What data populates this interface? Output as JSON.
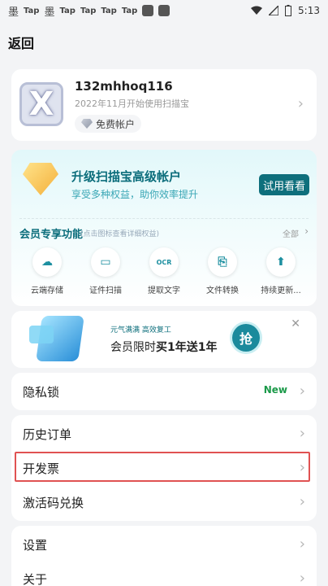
{
  "status_bar": {
    "app_icons": [
      "Tap",
      "Tap",
      "Tap",
      "Tap",
      "Tap"
    ],
    "time": "5:13"
  },
  "nav": {
    "back_label": "返回"
  },
  "profile": {
    "username": "132mhhoq116",
    "since": "2022年11月开始使用扫描宝",
    "account_type": "免费帐户"
  },
  "vip": {
    "title": "升级扫描宝高级帐户",
    "subtitle": "享受多种权益，助你效率提升",
    "try_label": "试用看看",
    "features_title": "会员专享功能",
    "features_hint": "(点击图标查看详细权益)",
    "all_label": "全部",
    "features": [
      {
        "label": "云端存储",
        "icon": "cloud-icon"
      },
      {
        "label": "证件扫描",
        "icon": "id-card-icon"
      },
      {
        "label": "提取文字",
        "icon": "ocr-icon"
      },
      {
        "label": "文件转换",
        "icon": "pdf-icon"
      },
      {
        "label": "持续更新...",
        "icon": "arrow-up-icon"
      }
    ]
  },
  "banner": {
    "small_text": "元气满满  高效复工",
    "main_prefix": "会员限时",
    "main_bold": "买1年送1年",
    "grab_label": "抢"
  },
  "menu": {
    "group1": [
      {
        "label": "隐私锁",
        "tag": "New"
      }
    ],
    "group2": [
      {
        "label": "历史订单"
      },
      {
        "label": "开发票"
      },
      {
        "label": "激活码兑换"
      }
    ],
    "group3": [
      {
        "label": "设置"
      },
      {
        "label": "关于"
      }
    ]
  },
  "colors": {
    "accent": "#0e6f7c",
    "highlight": "#e05252",
    "new_tag": "#1c9a4a"
  }
}
